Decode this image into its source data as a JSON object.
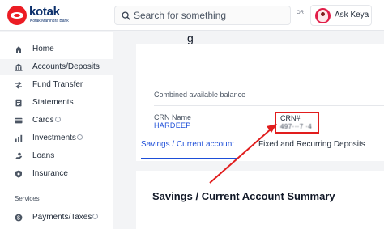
{
  "header": {
    "logo_text": "kotak",
    "logo_subtitle": "Kotak Mahindra Bank",
    "search_placeholder": "Search for something",
    "or_label": "OR",
    "ask_label": "Ask Keya"
  },
  "sidebar": {
    "items": [
      {
        "label": "Home",
        "icon": "home-icon"
      },
      {
        "label": "Accounts/Deposits",
        "icon": "bank-icon",
        "active": true
      },
      {
        "label": "Fund Transfer",
        "icon": "transfer-icon"
      },
      {
        "label": "Statements",
        "icon": "document-icon"
      },
      {
        "label": "Cards",
        "icon": "card-icon",
        "info": true
      },
      {
        "label": "Investments",
        "icon": "chart-icon",
        "info": true
      },
      {
        "label": "Loans",
        "icon": "loan-icon"
      },
      {
        "label": "Insurance",
        "icon": "shield-icon"
      }
    ],
    "section_label": "Services",
    "services": [
      {
        "label": "Payments/Taxes",
        "icon": "payments-icon",
        "info": true
      }
    ]
  },
  "main": {
    "heading_fragment": "g",
    "balance_label": "Combined available balance",
    "crn_name_label": "CRN Name",
    "crn_name_value": "HARDEEP",
    "crn_label": "CRN#",
    "crn_value": "497···7 ·4",
    "tabs": [
      {
        "label": "Savings / Current account",
        "active": true
      },
      {
        "label": "Fixed and Recurring Deposits",
        "active": false
      }
    ],
    "summary_title": "Savings / Current Account Summary"
  },
  "colors": {
    "brand_red": "#ec1c24",
    "brand_navy": "#0b2f6b",
    "link_blue": "#1d4ed8",
    "highlight_red": "#e11d1d"
  }
}
